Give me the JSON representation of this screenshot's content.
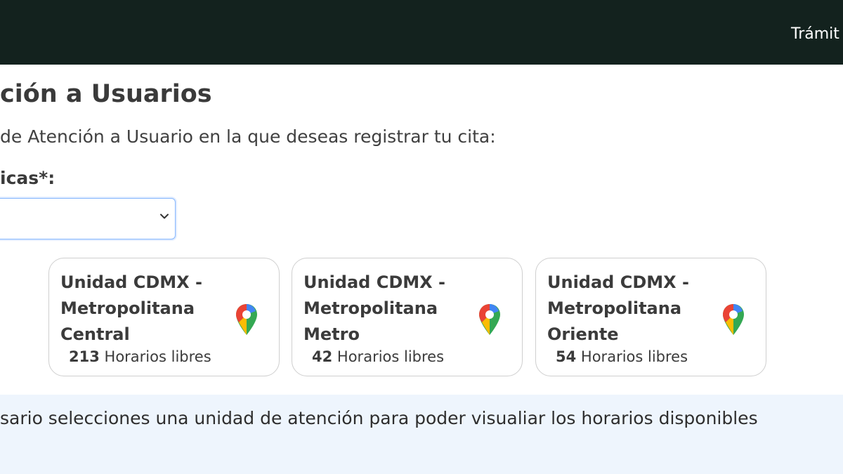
{
  "header": {
    "nav_link": "Trámit"
  },
  "page": {
    "title": "ción a Usuarios",
    "instruction": "de Atención a Usuario en la que deseas registrar tu cita:",
    "field_label": "icas*:",
    "select_value": ""
  },
  "units": [
    {
      "name": "Unidad CDMX - Metropolitana Central",
      "count": "213",
      "count_label": "Horarios libres"
    },
    {
      "name": "Unidad CDMX - Metropolitana Metro",
      "count": "42",
      "count_label": "Horarios libres"
    },
    {
      "name": "Unidad CDMX - Metropolitana Oriente",
      "count": "54",
      "count_label": "Horarios libres"
    }
  ],
  "alert": {
    "message": "sario selecciones una unidad de atención para poder visualiar los horarios disponibles"
  },
  "colors": {
    "header_bg": "#13221e",
    "select_border": "#86b7fe",
    "alert_bg": "#eef5fd"
  },
  "icons": {
    "select_arrow": "chevron-down-icon",
    "card_location": "map-pin-icon"
  }
}
